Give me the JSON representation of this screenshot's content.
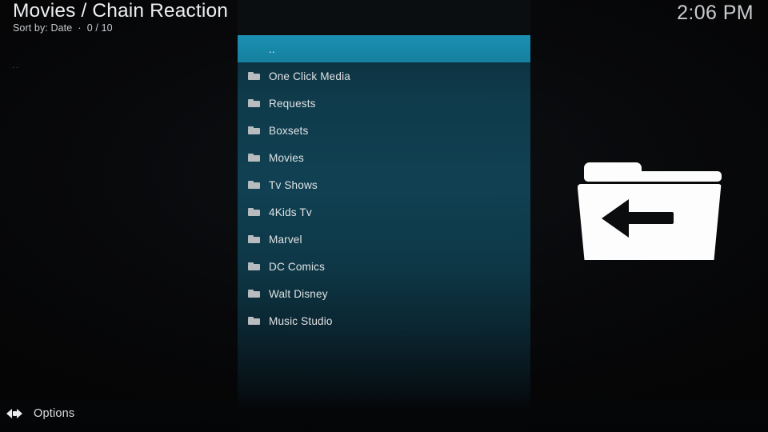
{
  "header": {
    "title": "Movies / Chain Reaction",
    "subtitle": "Sort by: Date  ·  0 / 10",
    "clock": "2:06 PM"
  },
  "left_rail": {
    "label": ".."
  },
  "list": {
    "items": [
      {
        "label": "..",
        "icon": "none",
        "selected": true
      },
      {
        "label": "One Click Media",
        "icon": "folder",
        "selected": false
      },
      {
        "label": "Requests",
        "icon": "folder",
        "selected": false
      },
      {
        "label": "Boxsets",
        "icon": "folder",
        "selected": false
      },
      {
        "label": "Movies",
        "icon": "folder",
        "selected": false
      },
      {
        "label": "Tv Shows",
        "icon": "folder",
        "selected": false
      },
      {
        "label": "4Kids Tv",
        "icon": "folder",
        "selected": false
      },
      {
        "label": "Marvel",
        "icon": "folder",
        "selected": false
      },
      {
        "label": "DC Comics",
        "icon": "folder",
        "selected": false
      },
      {
        "label": "Walt Disney",
        "icon": "folder",
        "selected": false
      },
      {
        "label": "Music Studio",
        "icon": "folder",
        "selected": false
      }
    ]
  },
  "preview": {
    "icon": "parent-folder-icon"
  },
  "bottom_bar": {
    "options_label": "Options",
    "options_icon": "left-right-arrows-icon"
  },
  "colors": {
    "background": "#050607",
    "panel_teal": "#0f3d4e",
    "highlight": "#1887a8",
    "text_primary": "#e8eaec",
    "text_secondary": "#c6cacd",
    "folder_icon": "#b9bcbe",
    "preview_icon": "#fdfdfd"
  }
}
